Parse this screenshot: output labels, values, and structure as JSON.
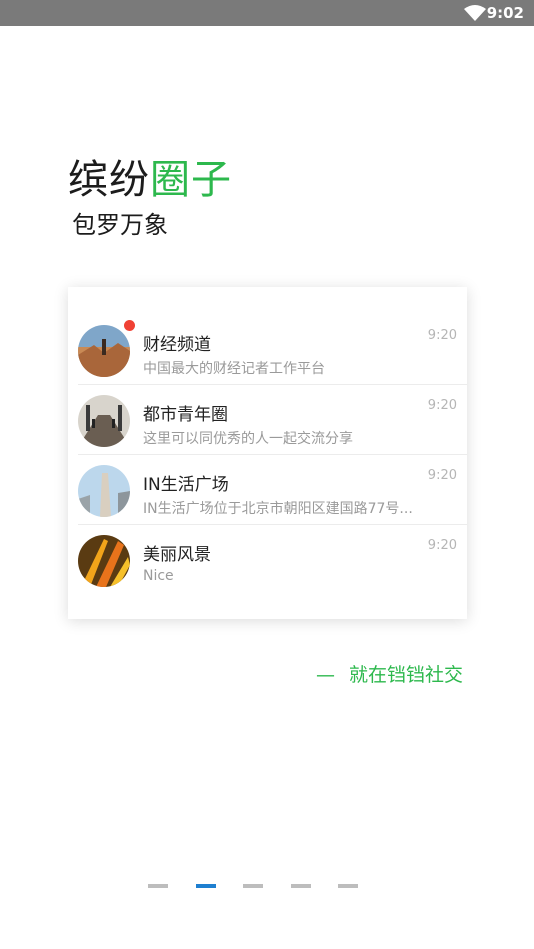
{
  "status_bar": {
    "time": "9:02",
    "wifi_icon": "wifi-icon"
  },
  "headline": {
    "part1": "缤纷",
    "part2": "圈子",
    "accent_color": "#2db84d"
  },
  "subheadline": "包罗万象",
  "chats": [
    {
      "title": "财经频道",
      "desc": "中国最大的财经记者工作平台",
      "time": "9:20",
      "unread": true
    },
    {
      "title": "都市青年圈",
      "desc": "这里可以同优秀的人一起交流分享",
      "time": "9:20",
      "unread": false
    },
    {
      "title": "IN生活广场",
      "desc": "IN生活广场位于北京市朝阳区建国路77号...",
      "time": "9:20",
      "unread": false
    },
    {
      "title": "美丽风景",
      "desc": "Nice",
      "time": "9:20",
      "unread": false
    }
  ],
  "tagline": {
    "dash": "—",
    "text": "就在铛铛社交"
  },
  "pager": {
    "count": 5,
    "active_index": 1,
    "active_color": "#1e7fd0"
  }
}
